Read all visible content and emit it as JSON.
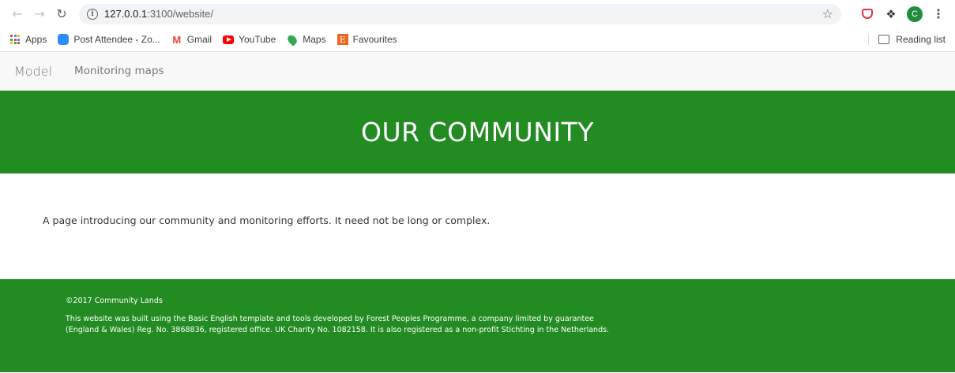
{
  "browser": {
    "url_host": "127.0.0.1",
    "url_rest": ":3100/website/",
    "avatar_letter": "C",
    "bookmarks": [
      {
        "label": "Apps",
        "icon": "apps-grid-icon"
      },
      {
        "label": "Post Attendee - Zo...",
        "icon": "zoom-icon"
      },
      {
        "label": "Gmail",
        "icon": "gmail-icon"
      },
      {
        "label": "YouTube",
        "icon": "youtube-icon"
      },
      {
        "label": "Maps",
        "icon": "maps-icon"
      },
      {
        "label": "Favourites",
        "icon": "favourites-icon"
      }
    ],
    "reading_list": "Reading list"
  },
  "nav": {
    "brand": "Model",
    "links": [
      "Monitoring maps"
    ]
  },
  "hero": {
    "title": "OUR COMMUNITY",
    "color": "#228b22"
  },
  "content": {
    "intro": "A page introducing our community and monitoring efforts. It need not be long or complex."
  },
  "footer": {
    "copyright": "©2017 Community Lands",
    "about": "This website was built using the Basic English template and tools developed by Forest Peoples Programme, a company limited by guarantee (England & Wales) Reg. No. 3868836, registered office. UK Charity No. 1082158. It is also registered as a non-profit Stichting in the Netherlands."
  }
}
